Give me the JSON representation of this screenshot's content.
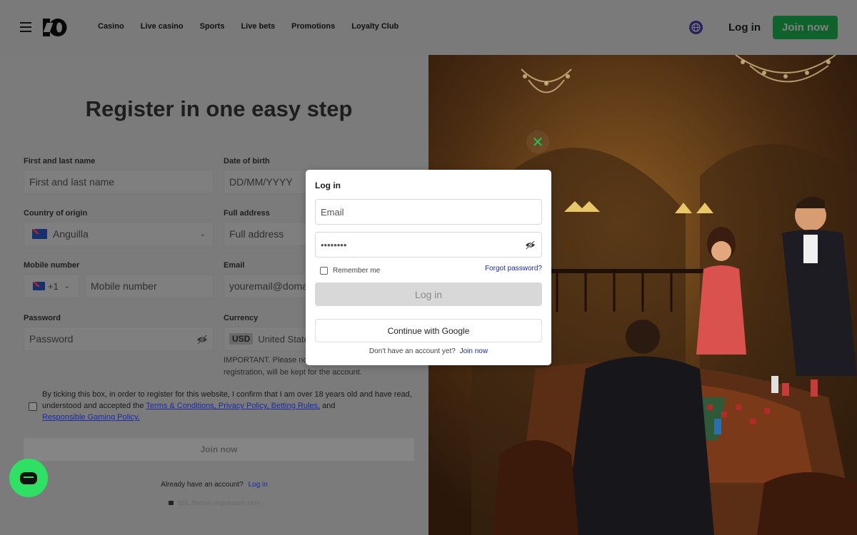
{
  "header": {
    "nav": [
      "Casino",
      "Live casino",
      "Sports",
      "Live bets",
      "Promotions",
      "Loyalty Club"
    ],
    "login_label": "Log in",
    "join_label": "Join now"
  },
  "register": {
    "title": "Register in one easy step",
    "name": {
      "label": "First and last name",
      "placeholder": "First and last name"
    },
    "dob": {
      "label": "Date of birth",
      "placeholder": "DD/MM/YYYY"
    },
    "country": {
      "label": "Country of origin",
      "value": "Anguilla"
    },
    "address": {
      "label": "Full address",
      "placeholder": "Full address"
    },
    "mobile": {
      "label": "Mobile number",
      "code": "+1",
      "placeholder": "Mobile number"
    },
    "email": {
      "label": "Email",
      "placeholder": "youremail@domain.com"
    },
    "password": {
      "label": "Password",
      "placeholder": "Password"
    },
    "currency": {
      "label": "Currency",
      "code": "USD",
      "name": "United States dollar"
    },
    "important": "IMPORTANT. Please note that the currency selected at registration, will be kept for the account.",
    "consent_text": "By ticking this box, in order to register for this website, I confirm that I am over 18 years old and have read, understood and accepted the",
    "consent_links": "Terms & Conditions, Privacy Policy, Betting Rules,",
    "consent_and": "and",
    "consent_rgp": "Responsible Gaming Policy.",
    "join_label": "Join now",
    "already_text": "Already have an account?",
    "already_login": "Log in",
    "secure_text": "SSL Secure registration form"
  },
  "modal": {
    "title": "Log in",
    "email_placeholder": "Email",
    "password_value": "••••••••",
    "remember": "Remember me",
    "forgot": "Forgot password?",
    "login_label": "Log in",
    "google_label": "Continue with Google",
    "no_account": "Don't have an account yet?",
    "join_link": "Join now"
  },
  "colors": {
    "accent_green": "#1fc45a",
    "link_blue": "#1b2aa3"
  }
}
